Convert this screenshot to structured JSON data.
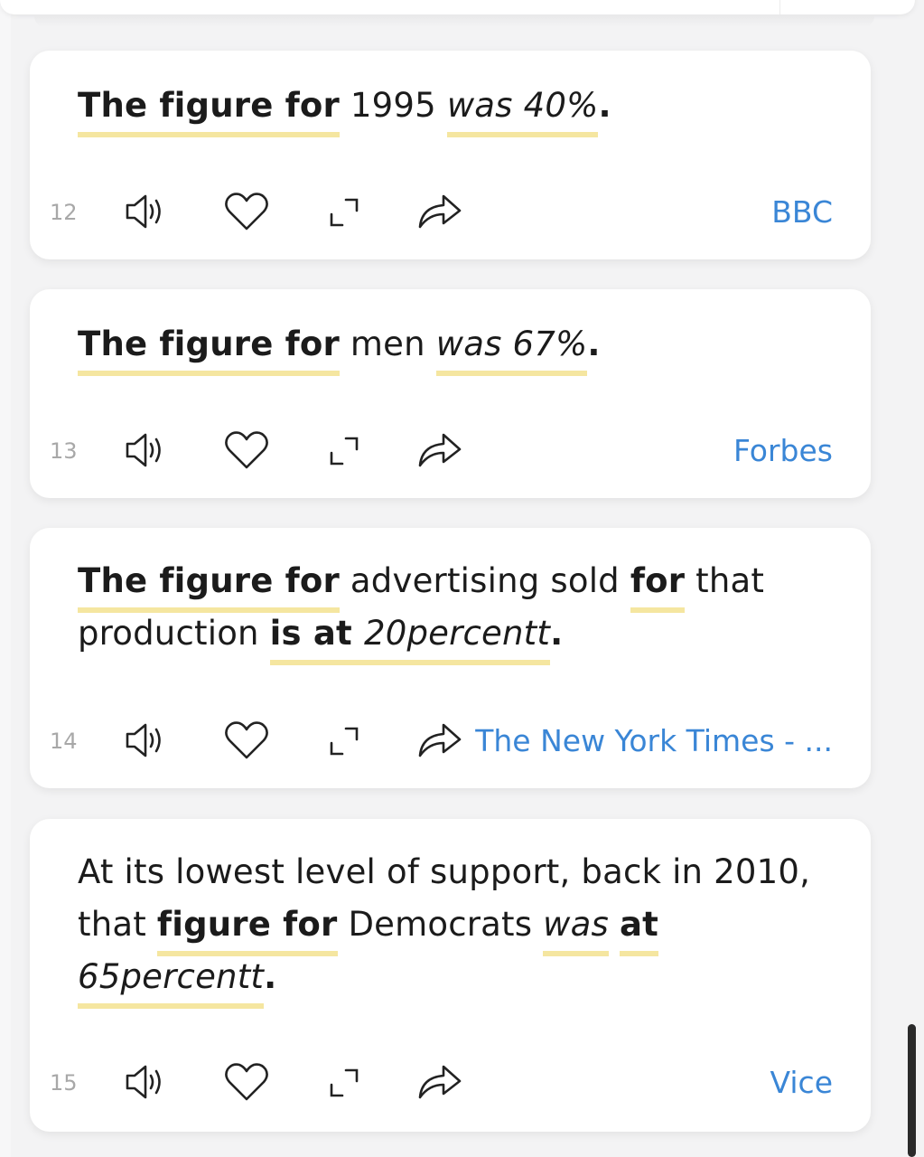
{
  "colors": {
    "highlight": "#f5e6a0",
    "source_link": "#3a86d6",
    "number": "#a8a8a8",
    "card_bg": "#ffffff",
    "page_bg": "#f3f3f4"
  },
  "icons": [
    "speaker-icon",
    "heart-icon",
    "expand-icon",
    "share-icon"
  ],
  "cards": [
    {
      "number": "12",
      "source": "BBC",
      "segments": [
        {
          "text": "The figure for",
          "style": "b hl"
        },
        {
          "text": " 1995 ",
          "style": ""
        },
        {
          "text": "was 40%",
          "style": "i hl"
        },
        {
          "text": ".",
          "style": "b"
        }
      ]
    },
    {
      "number": "13",
      "source": "Forbes",
      "segments": [
        {
          "text": "The figure for",
          "style": "b hl"
        },
        {
          "text": " men ",
          "style": ""
        },
        {
          "text": "was 67%",
          "style": "i hl"
        },
        {
          "text": ".",
          "style": "b"
        }
      ]
    },
    {
      "number": "14",
      "source": "The New York Times - ...",
      "segments": [
        {
          "text": "The figure for",
          "style": "b hl"
        },
        {
          "text": " advertising sold ",
          "style": ""
        },
        {
          "text": "for",
          "style": "b hl"
        },
        {
          "text": " that production ",
          "style": ""
        },
        {
          "text": "is at ",
          "style": "b hl"
        },
        {
          "text": "20percentt",
          "style": "i hl"
        },
        {
          "text": ".",
          "style": "b"
        }
      ]
    },
    {
      "number": "15",
      "source": "Vice",
      "segments": [
        {
          "text": "At its lowest level of support, back in 2010, that ",
          "style": ""
        },
        {
          "text": "figure for",
          "style": "b hl"
        },
        {
          "text": " Democrats ",
          "style": ""
        },
        {
          "text": "was",
          "style": "i hl"
        },
        {
          "text": " ",
          "style": ""
        },
        {
          "text": "at",
          "style": "b hl"
        },
        {
          "text": " ",
          "style": ""
        },
        {
          "text": "65percentt",
          "style": "i hl"
        },
        {
          "text": ".",
          "style": "b"
        }
      ]
    }
  ]
}
